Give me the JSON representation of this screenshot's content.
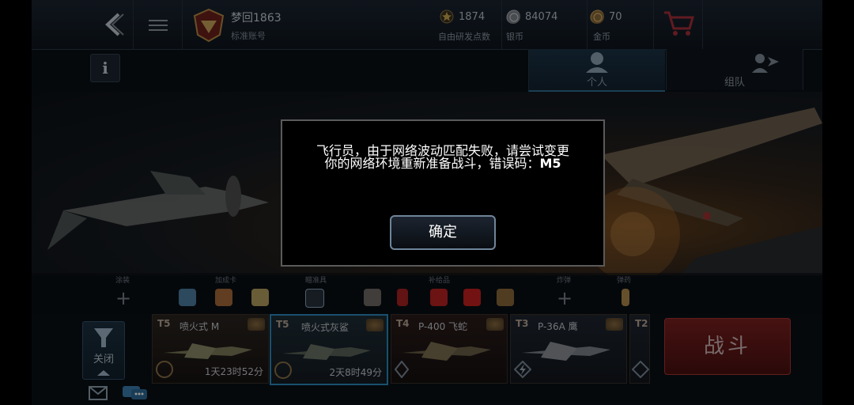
{
  "header": {
    "player_name": "梦回1863",
    "account_type": "标准账号",
    "resources": [
      {
        "value": "1874",
        "label": "自由研发点数",
        "icon": "star-icon"
      },
      {
        "value": "84074",
        "label": "银币",
        "icon": "silver-coin-icon"
      },
      {
        "value": "70",
        "label": "金币",
        "icon": "gold-coin-icon"
      }
    ]
  },
  "tabs": [
    {
      "label": "个人",
      "icon": "pilot-icon",
      "selected": true
    },
    {
      "label": "组队",
      "icon": "squad-icon",
      "selected": false
    }
  ],
  "equipment_labels": [
    "涂装",
    "加成卡",
    "瞄准具",
    "补给品",
    "炸弹",
    "弹药"
  ],
  "filter": {
    "label": "关闭"
  },
  "aircraft": [
    {
      "tier": "T5",
      "name": "喷火式 M",
      "timer": "1天23时52分",
      "selected": false
    },
    {
      "tier": "T5",
      "name": "喷火式灰鲨",
      "timer": "2天8时49分",
      "selected": true
    },
    {
      "tier": "T4",
      "name": "P-400 飞蛇",
      "timer": "",
      "selected": false
    },
    {
      "tier": "T3",
      "name": "P-36A 鹰",
      "timer": "",
      "selected": false
    },
    {
      "tier": "T2",
      "name": "",
      "timer": "",
      "selected": false
    }
  ],
  "battle": {
    "label": "战斗"
  },
  "dialog": {
    "line1": "飞行员，由于网络波动匹配失败，请尝试变更",
    "line2": "你的网络环境重新准备战斗，错误码：",
    "code": "M5",
    "confirm_label": "确定"
  },
  "colors": {
    "accent": "#2e8bbd",
    "battle": "#7a1f1f",
    "dialog_bg": "#000000"
  }
}
